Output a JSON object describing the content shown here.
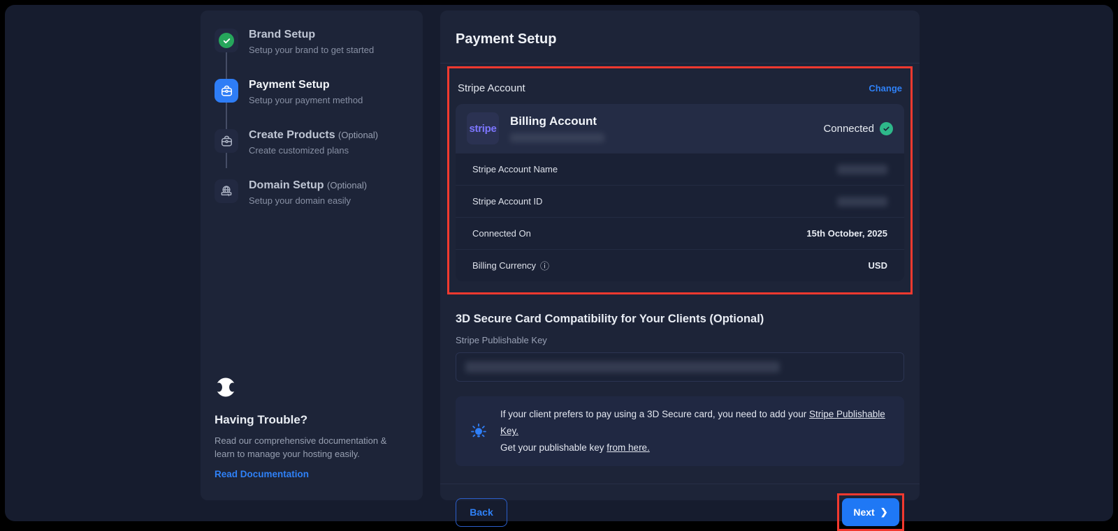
{
  "sidebar": {
    "steps": [
      {
        "title": "Brand Setup",
        "optional": "",
        "subtitle": "Setup your brand to get started",
        "state": "done"
      },
      {
        "title": "Payment Setup",
        "optional": "",
        "subtitle": "Setup your payment method",
        "state": "active"
      },
      {
        "title": "Create Products",
        "optional": "(Optional)",
        "subtitle": "Create customized plans",
        "state": "todo"
      },
      {
        "title": "Domain Setup",
        "optional": "(Optional)",
        "subtitle": "Setup your domain easily",
        "state": "todo"
      }
    ],
    "help": {
      "title": "Having Trouble?",
      "description": "Read our comprehensive documentation & learn to manage your hosting easily.",
      "link_label": "Read Documentation"
    }
  },
  "main": {
    "title": "Payment Setup",
    "stripe_section": {
      "label": "Stripe Account",
      "change_label": "Change",
      "provider_logo": "stripe",
      "account_title": "Billing Account",
      "status_label": "Connected",
      "rows": [
        {
          "label": "Stripe Account Name",
          "value": "",
          "redacted": true
        },
        {
          "label": "Stripe Account ID",
          "value": "",
          "redacted": true
        },
        {
          "label": "Connected On",
          "value": "15th October, 2025"
        },
        {
          "label": "Billing Currency",
          "value": "USD",
          "has_info_icon": true
        }
      ]
    },
    "secure_section": {
      "title": "3D Secure Card Compatibility for Your Clients (Optional)",
      "input_label": "Stripe Publishable Key",
      "input_value_redacted": true,
      "info_line1_prefix": "If your client prefers to pay using a 3D Secure card, you need to add your ",
      "info_line1_link": "Stripe Publishable Key.",
      "info_line2_prefix": "Get your publishable key ",
      "info_line2_link": "from here."
    },
    "footer": {
      "back_label": "Back",
      "next_label": "Next"
    }
  },
  "icons": {
    "info": "ⓘ",
    "chevron_right": "❯"
  },
  "colors": {
    "accent_blue": "#2e7df6",
    "success_green": "#26a65b",
    "connected_teal": "#2eb88a",
    "annotation_red": "#f2392f",
    "stripe_purple": "#7d76ff",
    "panel_bg": "#1d2438",
    "page_bg": "#161c2e"
  }
}
